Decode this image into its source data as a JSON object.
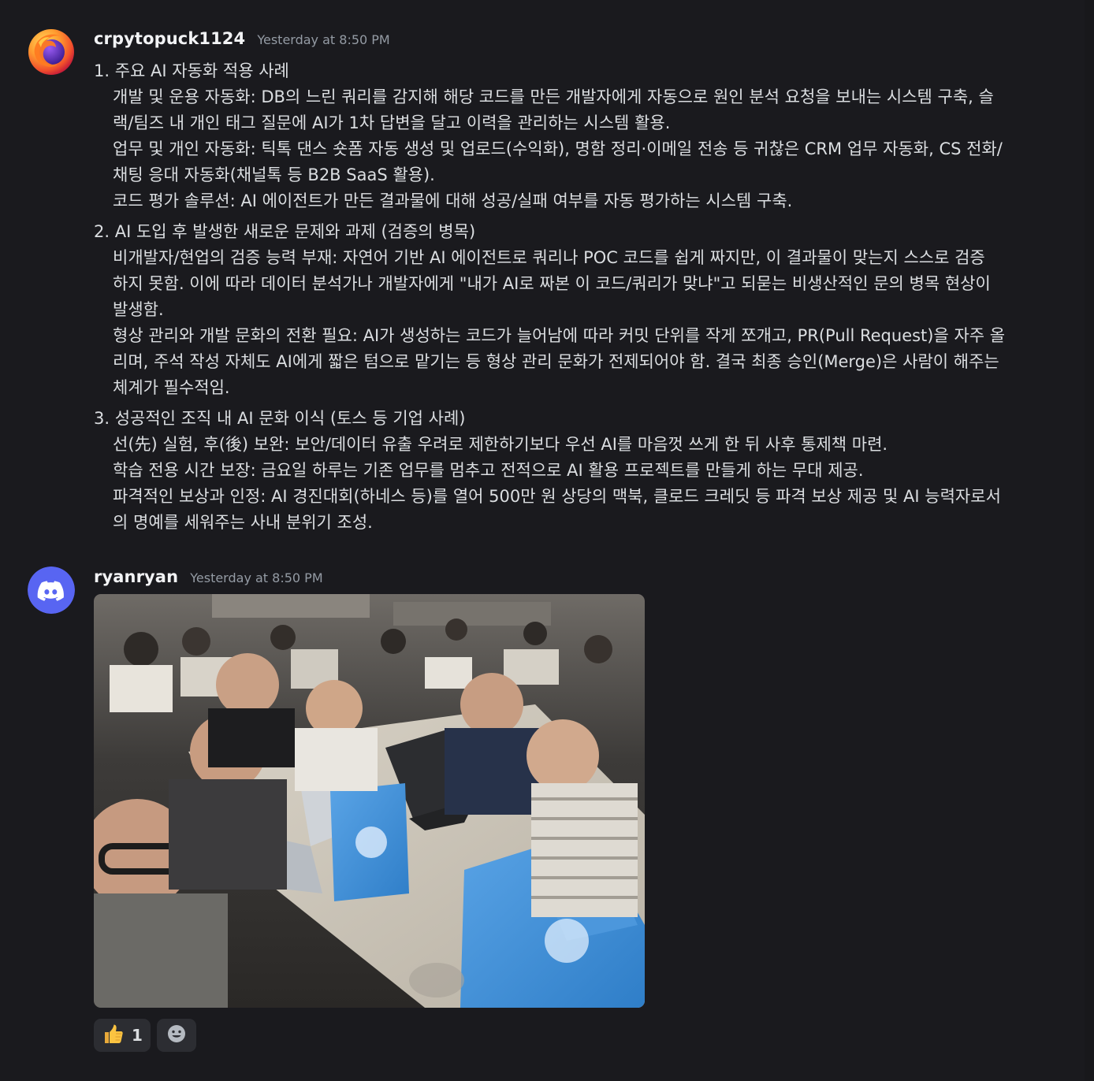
{
  "messages": [
    {
      "username": "crpytopuck1124",
      "timestamp": "Yesterday at 8:50 PM",
      "avatar_icon": "firefox-icon",
      "sections": [
        {
          "title": "1. 주요 AI 자동화 적용 사례",
          "lines": [
            "개발 및 운용 자동화: DB의 느린 쿼리를 감지해 해당 코드를 만든 개발자에게 자동으로 원인 분석 요청을 보내는 시스템 구축, 슬",
            "랙/팀즈 내 개인 태그 질문에 AI가 1차 답변을 달고 이력을 관리하는 시스템 활용.",
            "업무 및 개인 자동화: 틱톡 댄스 숏폼 자동 생성 및 업로드(수익화), 명함 정리·이메일 전송 등 귀찮은 CRM 업무 자동화, CS 전화/",
            "채팅 응대 자동화(채널톡 등 B2B SaaS 활용).",
            "코드 평가 솔루션: AI 에이전트가 만든 결과물에 대해 성공/실패 여부를 자동 평가하는 시스템 구축."
          ]
        },
        {
          "title": "2. AI 도입 후 발생한 새로운 문제와 과제 (검증의 병목)",
          "lines": [
            "비개발자/현업의 검증 능력 부재: 자연어 기반 AI 에이전트로 쿼리나 POC 코드를 쉽게 짜지만, 이 결과물이 맞는지 스스로 검증",
            "하지 못함. 이에 따라 데이터 분석가나 개발자에게 \"내가 AI로 짜본 이 코드/쿼리가 맞냐\"고 되묻는 비생산적인 문의 병목 현상이",
            "발생함.",
            "형상 관리와 개발 문화의 전환 필요: AI가 생성하는 코드가 늘어남에 따라 커밋 단위를 작게 쪼개고, PR(Pull Request)을 자주 올",
            "리며, 주석 작성 자체도 AI에게 짧은 텀으로 맡기는 등 형상 관리 문화가 전제되어야 함. 결국 최종 승인(Merge)은 사람이 해주는",
            "체계가 필수적임."
          ]
        },
        {
          "title": "3. 성공적인 조직 내 AI 문화 이식 (토스 등 기업 사례)",
          "lines": [
            "선(先) 실험, 후(後) 보완: 보안/데이터 유출 우려로 제한하기보다 우선 AI를 마음껏 쓰게 한 뒤 사후 통제책 마련.",
            "학습 전용 시간 보장: 금요일 하루는 기존 업무를 멈추고 전적으로 AI 활용 프로젝트를 만들게 하는 무대 제공.",
            "파격적인 보상과 인정: AI 경진대회(하네스 등)를 열어 500만 원 상당의 맥북, 클로드 크레딧 등 파격 보상 제공 및 AI 능력자로서",
            "의 명예를 세워주는 사내 분위기 조성."
          ]
        }
      ]
    },
    {
      "username": "ryanryan",
      "timestamp": "Yesterday at 8:50 PM",
      "avatar_icon": "discord-icon",
      "attachment_icon": "photo-attachment",
      "reactions": [
        {
          "emoji": "thumbs-up-icon",
          "count": "1"
        }
      ],
      "add_reaction_icon": "add-reaction-icon"
    }
  ],
  "colors": {
    "background": "#1a1a1e",
    "username": "#f2f3f5",
    "timestamp": "#949ba4",
    "text": "#dbdee1",
    "discord_blurple": "#5865f2",
    "reaction_bg": "#2c2d32"
  }
}
